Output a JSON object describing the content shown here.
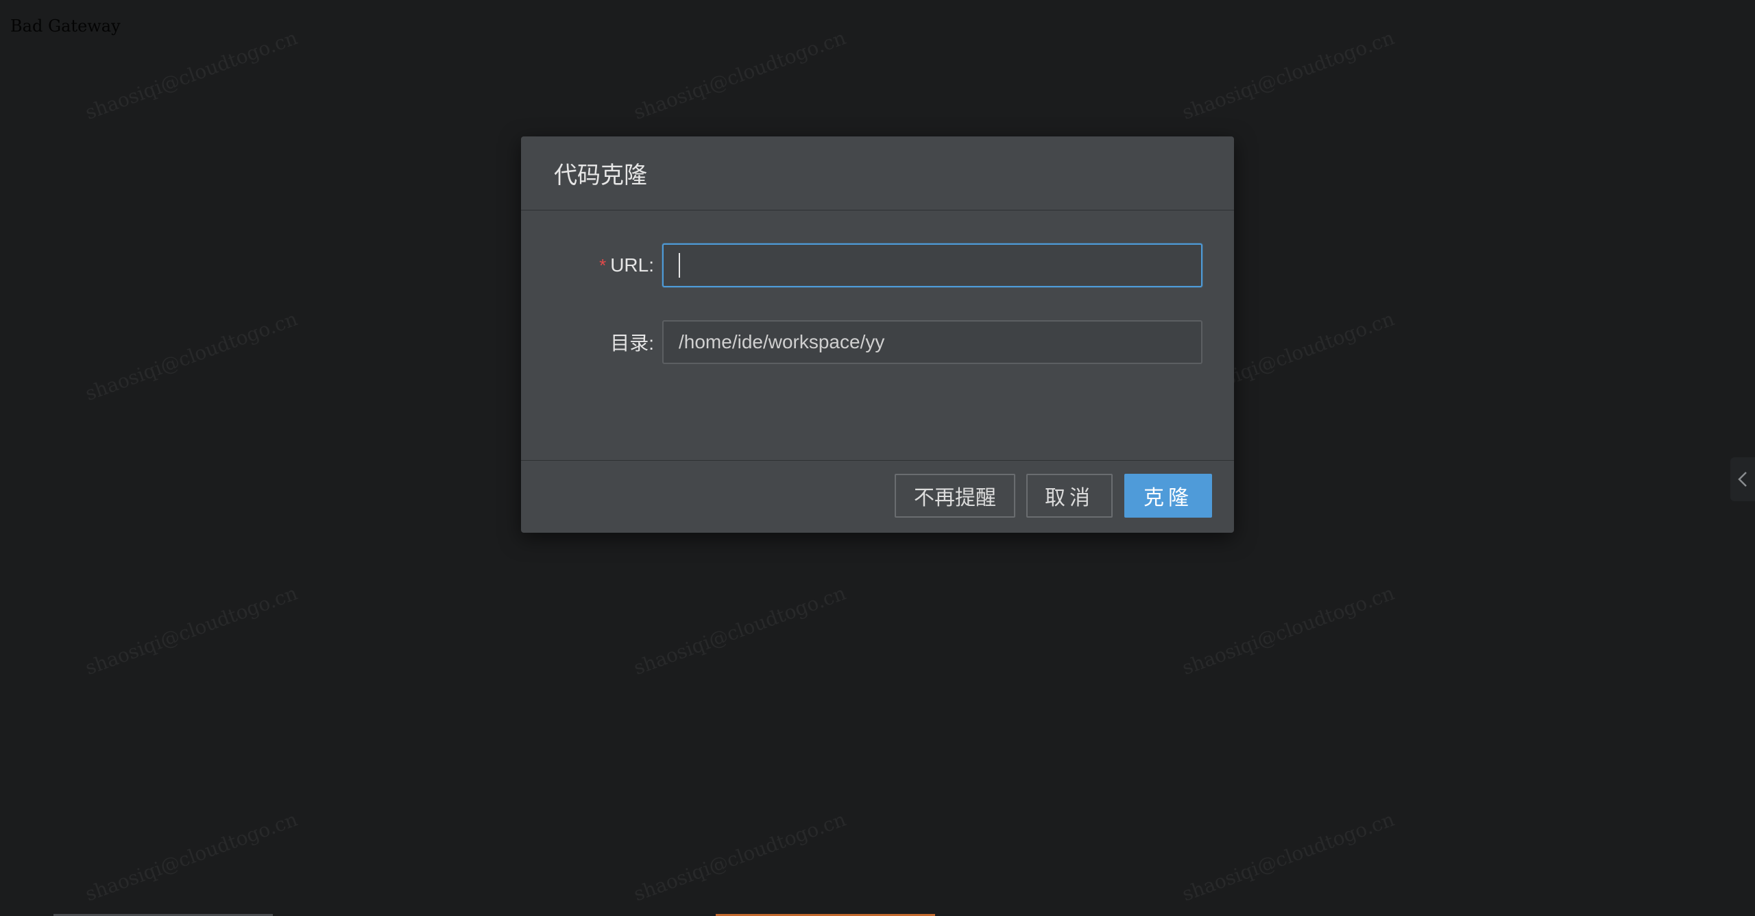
{
  "page": {
    "error_text": "Bad Gateway"
  },
  "watermark": {
    "text": "shaosiqi@cloudtogo.cn"
  },
  "dialog": {
    "title": "代码克隆",
    "fields": [
      {
        "label": "URL:",
        "required": true,
        "value": "",
        "focused": true
      },
      {
        "label": "目录:",
        "required": false,
        "value": "/home/ide/workspace/yy"
      }
    ],
    "buttons": {
      "no_remind": "不再提醒",
      "cancel": "取消",
      "clone": "克隆"
    }
  },
  "colors": {
    "background": "#1b1c1d",
    "dialog_bg": "#45484b",
    "accent": "#4f9bd9",
    "required_marker": "#e34a4a"
  },
  "icons": {
    "side_handle": "chevron-left-icon"
  }
}
